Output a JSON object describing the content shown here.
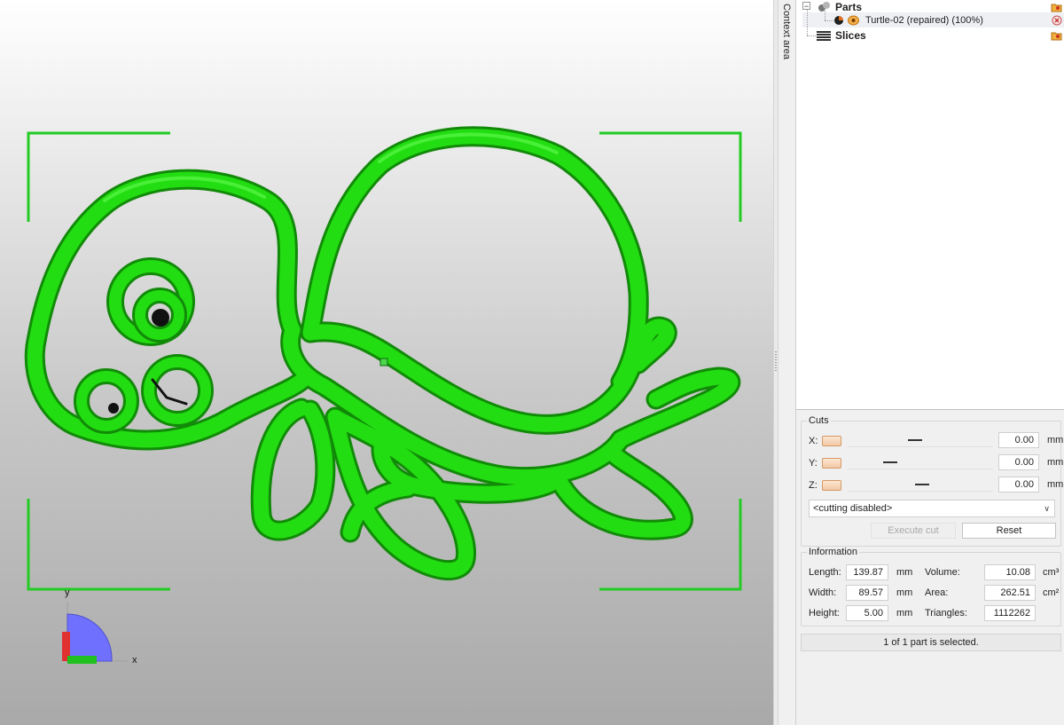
{
  "context_tab": {
    "label": "Context area"
  },
  "tree": {
    "parts_label": "Parts",
    "part_item_label": "Turtle-02 (repaired) (100%)",
    "slices_label": "Slices"
  },
  "cuts": {
    "title": "Cuts",
    "axes": [
      {
        "label": "X:",
        "value": "0.00",
        "unit": "mm"
      },
      {
        "label": "Y:",
        "value": "0.00",
        "unit": "mm"
      },
      {
        "label": "Z:",
        "value": "0.00",
        "unit": "mm"
      }
    ],
    "mode_select": "<cutting disabled>",
    "execute_label": "Execute cut",
    "reset_label": "Reset"
  },
  "info": {
    "title": "Information",
    "length_label": "Length:",
    "length_value": "139.87",
    "length_unit": "mm",
    "width_label": "Width:",
    "width_value": "89.57",
    "width_unit": "mm",
    "height_label": "Height:",
    "height_value": "5.00",
    "height_unit": "mm",
    "volume_label": "Volume:",
    "volume_value": "10.08",
    "volume_unit": "cm³",
    "area_label": "Area:",
    "area_value": "262.51",
    "area_unit": "cm²",
    "triangles_label": "Triangles:",
    "triangles_value": "1112262"
  },
  "status": "1 of 1 part is selected.",
  "gizmo": {
    "x_label": "x",
    "y_label": "y"
  },
  "colors": {
    "model": "#22dd11",
    "model_dark": "#159e0b",
    "selection_bracket": "#22cc22"
  }
}
